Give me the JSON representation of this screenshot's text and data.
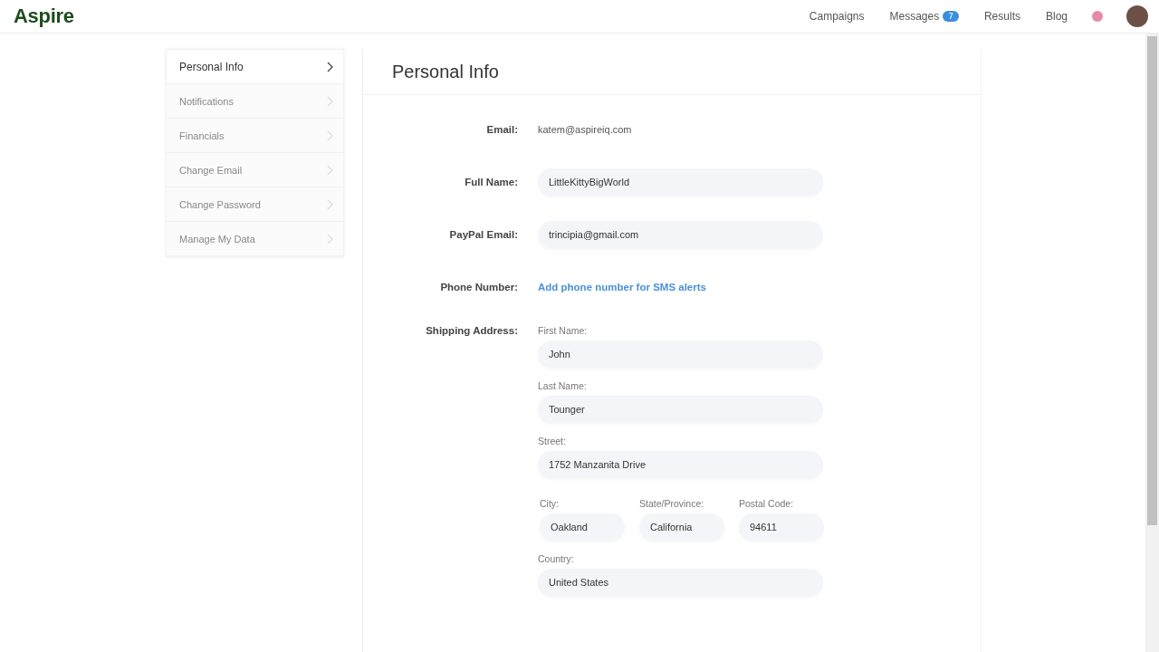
{
  "header": {
    "logo": "Aspire",
    "nav": [
      {
        "label": "Campaigns"
      },
      {
        "label": "Messages",
        "badge": "7"
      },
      {
        "label": "Results"
      },
      {
        "label": "Blog"
      }
    ]
  },
  "sidebar": {
    "items": [
      {
        "label": "Personal Info",
        "selected": true
      },
      {
        "label": "Notifications",
        "selected": false
      },
      {
        "label": "Financials",
        "selected": false
      },
      {
        "label": "Change Email",
        "selected": false
      },
      {
        "label": "Change Password",
        "selected": false
      },
      {
        "label": "Manage My Data",
        "selected": false
      }
    ]
  },
  "panel": {
    "title": "Personal Info",
    "rows": [
      {
        "kind": "text",
        "label": "Email:",
        "value": "katem@aspireiq.com"
      },
      {
        "kind": "input",
        "label": "Full Name:",
        "value": "LittleKittyBigWorld"
      },
      {
        "kind": "input",
        "label": "PayPal Email:",
        "value": "trincipia@gmail.com"
      },
      {
        "kind": "link",
        "label": "Phone Number:",
        "value": "Add phone number for SMS alerts"
      },
      {
        "kind": "address",
        "label": "Shipping Address:",
        "groups": [
          [
            {
              "label": "First Name:",
              "value": "John"
            }
          ],
          [
            {
              "label": "Last Name:",
              "value": "Tounger"
            }
          ],
          [
            {
              "label": "Street:",
              "value": "1752 Manzanita Drive"
            }
          ],
          [
            {
              "label": "City:",
              "value": "Oakland"
            },
            {
              "label": "State/Province:",
              "value": "California"
            },
            {
              "label": "Postal Code:",
              "value": "94611"
            }
          ],
          [
            {
              "label": "Country:",
              "value": "United States"
            }
          ]
        ]
      }
    ]
  }
}
